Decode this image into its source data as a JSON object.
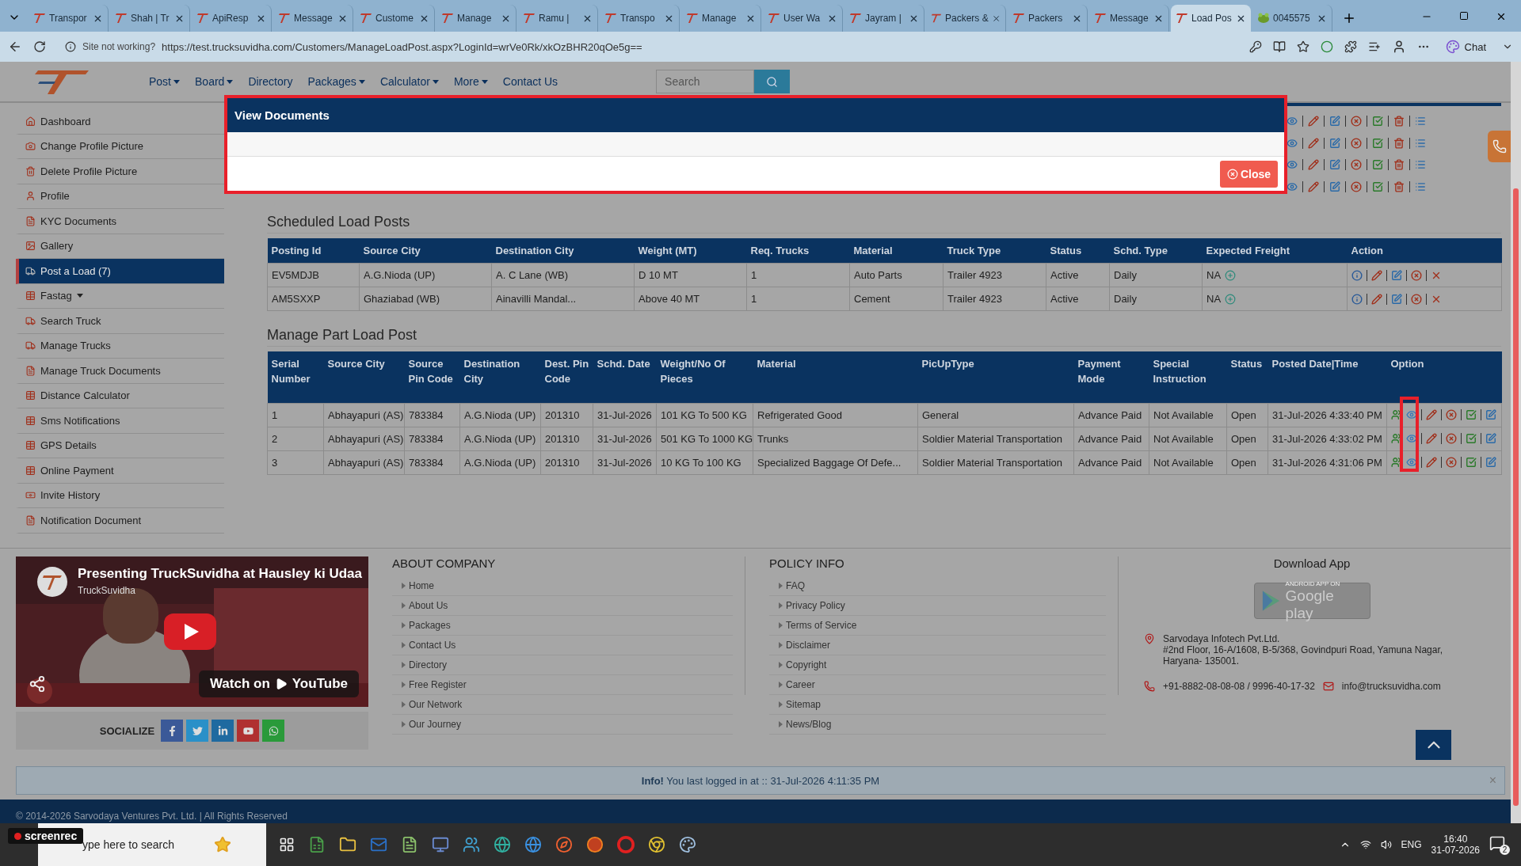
{
  "browser": {
    "tabs": [
      {
        "label": "Transpor",
        "kind": "site",
        "selected": false
      },
      {
        "label": "Shah | Tr",
        "kind": "site",
        "selected": false
      },
      {
        "label": "ApiResp",
        "kind": "site",
        "selected": false
      },
      {
        "label": "Message",
        "kind": "site",
        "selected": false
      },
      {
        "label": "Custome",
        "kind": "site",
        "selected": false
      },
      {
        "label": "Manage",
        "kind": "site",
        "selected": false
      },
      {
        "label": "Ramu | ",
        "kind": "site",
        "selected": false
      },
      {
        "label": "Transpo",
        "kind": "site",
        "selected": false
      },
      {
        "label": "Manage",
        "kind": "site",
        "selected": false
      },
      {
        "label": "User Wa",
        "kind": "site",
        "selected": false
      },
      {
        "label": "Jayram |",
        "kind": "site",
        "selected": false
      },
      {
        "label": "Packers &",
        "kind": "site",
        "selected": false
      },
      {
        "label": "Packers",
        "kind": "site",
        "selected": false
      },
      {
        "label": "Message",
        "kind": "site",
        "selected": false
      },
      {
        "label": "Load Pos",
        "kind": "site",
        "selected": true
      },
      {
        "label": "0045575",
        "kind": "frog",
        "selected": false
      }
    ],
    "site_warning": "Site not working?",
    "url": "https://test.trucksuvidha.com/Customers/ManageLoadPost.aspx?LoginId=wrVe0Rk/xkOzBHR20qOe5g==",
    "chat": "Chat"
  },
  "nav": {
    "items": [
      {
        "label": "Post",
        "dropdown": true
      },
      {
        "label": "Board",
        "dropdown": true
      },
      {
        "label": "Directory",
        "dropdown": false
      },
      {
        "label": "Packages",
        "dropdown": true
      },
      {
        "label": "Calculator",
        "dropdown": true
      },
      {
        "label": "More",
        "dropdown": true
      },
      {
        "label": "Contact Us",
        "dropdown": false
      }
    ],
    "search": {
      "placeholder": "Search"
    }
  },
  "sidebar": {
    "items": [
      {
        "label": "Dashboard",
        "selected": false
      },
      {
        "label": "Change Profile Picture",
        "selected": false
      },
      {
        "label": "Delete Profile Picture",
        "selected": false
      },
      {
        "label": "Profile",
        "selected": false
      },
      {
        "label": "KYC Documents",
        "selected": false
      },
      {
        "label": "Gallery",
        "selected": false
      },
      {
        "label": "Post a Load (7)",
        "selected": true
      },
      {
        "label": "Fastag",
        "selected": false,
        "dropdown": true
      },
      {
        "label": "Search Truck",
        "selected": false
      },
      {
        "label": "Manage Trucks",
        "selected": false
      },
      {
        "label": "Manage Truck Documents",
        "selected": false
      },
      {
        "label": "Distance Calculator",
        "selected": false
      },
      {
        "label": "Sms Notifications",
        "selected": false
      },
      {
        "label": "GPS Details",
        "selected": false
      },
      {
        "label": "Online Payment",
        "selected": false
      },
      {
        "label": "Invite History",
        "selected": false
      },
      {
        "label": "Notification Document",
        "selected": false
      }
    ]
  },
  "modal": {
    "title": "View Documents",
    "close_button": "Close"
  },
  "scheduled": {
    "title": "Scheduled Load Posts",
    "columns": [
      "Posting Id",
      "Source City",
      "Destination City",
      "Weight (MT)",
      "Req. Trucks",
      "Material",
      "Truck Type",
      "Status",
      "Schd. Type",
      "Expected Freight",
      "Action"
    ],
    "rows": [
      [
        "EV5MDJB",
        "A.G.Nioda (UP)",
        "A. C Lane (WB)",
        "D 10 MT",
        "1",
        "Auto Parts",
        "Trailer 4923",
        "Active",
        "Daily",
        "NA"
      ],
      [
        "AM5SXXP",
        "Ghaziabad (WB)",
        "Ainavilli Mandal...",
        "Above 40 MT",
        "1",
        "Cement",
        "Trailer 4923",
        "Active",
        "Daily",
        "NA"
      ]
    ]
  },
  "part_load": {
    "title": "Manage Part Load Post",
    "columns": [
      "Serial Number",
      "Source City",
      "Source Pin Code",
      "Destination City",
      "Dest. Pin Code",
      "Schd. Date",
      "Weight/No Of Pieces",
      "Material",
      "PicUpType",
      "Payment Mode",
      "Special Instruction",
      "Status",
      "Posted Date|Time",
      "Option"
    ],
    "rows": [
      [
        "1",
        "Abhayapuri (AS)",
        "783384",
        "A.G.Nioda (UP)",
        "201310",
        "31-Jul-2026",
        "101 KG To 500 KG",
        "Refrigerated Good",
        "General",
        "Advance Paid",
        "Not Available",
        "Open",
        "31-Jul-2026 4:33:40 PM"
      ],
      [
        "2",
        "Abhayapuri (AS)",
        "783384",
        "A.G.Nioda (UP)",
        "201310",
        "31-Jul-2026",
        "501 KG To 1000 KG",
        "Trunks",
        "Soldier Material Transportation",
        "Advance Paid",
        "Not Available",
        "Open",
        "31-Jul-2026 4:33:02 PM"
      ],
      [
        "3",
        "Abhayapuri (AS)",
        "783384",
        "A.G.Nioda (UP)",
        "201310",
        "31-Jul-2026",
        "10 KG To 100 KG",
        "Specialized Baggage Of Defe...",
        "Soldier Material Transportation",
        "Advance Paid",
        "Not Available",
        "Open",
        "31-Jul-2026 4:31:06 PM"
      ]
    ]
  },
  "footer": {
    "video": {
      "title": "Presenting TruckSuvidha at Hausley ki Udaa",
      "channel": "TruckSuvidha",
      "watch_on": "Watch on",
      "platform": "YouTube"
    },
    "socialize": "SOCIALIZE",
    "about": {
      "title": "ABOUT COMPANY",
      "links": [
        "Home",
        "About Us",
        "Packages",
        "Contact Us",
        "Directory",
        "Free Register",
        "Our Network",
        "Our Journey"
      ]
    },
    "policy": {
      "title": "POLICY INFO",
      "links": [
        "FAQ",
        "Privacy Policy",
        "Terms of Service",
        "Disclaimer",
        "Copyright",
        "Career",
        "Sitemap",
        "News/Blog"
      ]
    },
    "download": {
      "title": "Download App",
      "badge_small": "ANDROID APP ON",
      "badge": "Google play",
      "company": "Sarvodaya Infotech Pvt.Ltd.",
      "address": "#2nd Floor, 16-A/1608, B-5/368, Govindpuri Road, Yamuna Nagar, Haryana- 135001.",
      "phone": "+91-8882-08-08-08 / 9996-40-17-32",
      "email": "info@trucksuvidha.com"
    }
  },
  "info_alert": {
    "text": "**Info!** You last logged in at :: 31-Jul-2026 4:11:35 PM",
    "close": "×"
  },
  "copyright": "© 2014-2026 Sarvodaya Ventures Pvt. Ltd. | All Rights Reserved",
  "recorder_badge": "screenrec",
  "taskbar": {
    "search": {
      "placeholder": "ype here to search"
    },
    "language": "ENG",
    "time": "16:40",
    "date": "31-07-2026",
    "notifications": "2"
  }
}
